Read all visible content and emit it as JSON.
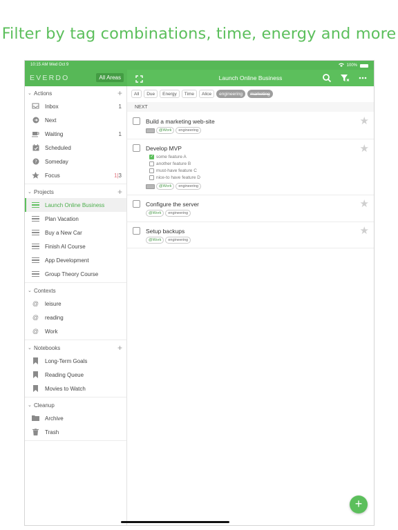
{
  "headline": "Filter by tag combinations, time, energy and more",
  "status_bar": {
    "time": "10:15 AM  Wed Oct 9",
    "battery": "100%"
  },
  "sidebar_header": {
    "brand": "EVERDO",
    "areas_button": "All Areas"
  },
  "main_header": {
    "title": "Launch Online Business"
  },
  "sidebar": {
    "actions": {
      "label": "Actions",
      "items": [
        {
          "label": "Inbox",
          "count": "1",
          "icon": "inbox-icon"
        },
        {
          "label": "Next",
          "count": "",
          "icon": "next-arrow-icon"
        },
        {
          "label": "Waiting",
          "count": "1",
          "icon": "coffee-icon"
        },
        {
          "label": "Scheduled",
          "count": "",
          "icon": "calendar-icon"
        },
        {
          "label": "Someday",
          "count": "",
          "icon": "question-icon"
        },
        {
          "label": "Focus",
          "count_a": "1",
          "count_sep": "|",
          "count_b": "3",
          "icon": "star-icon"
        }
      ]
    },
    "projects": {
      "label": "Projects",
      "items": [
        {
          "label": "Launch Online Business",
          "active": true
        },
        {
          "label": "Plan Vacation"
        },
        {
          "label": "Buy a New Car"
        },
        {
          "label": "Finish AI Course"
        },
        {
          "label": "App Development"
        },
        {
          "label": "Group Theory Course"
        }
      ]
    },
    "contexts": {
      "label": "Contexts",
      "items": [
        {
          "label": "leisure"
        },
        {
          "label": "reading"
        },
        {
          "label": "Work"
        }
      ]
    },
    "notebooks": {
      "label": "Notebooks",
      "items": [
        {
          "label": "Long-Term Goals"
        },
        {
          "label": "Reading Queue"
        },
        {
          "label": "Movies to Watch"
        }
      ]
    },
    "cleanup": {
      "label": "Cleanup",
      "items": [
        {
          "label": "Archive"
        },
        {
          "label": "Trash"
        }
      ]
    }
  },
  "filters": [
    "All",
    "Due",
    "Energy",
    "Time",
    "Alice",
    "engineering",
    "marketing"
  ],
  "section_label": "NEXT",
  "tasks": [
    {
      "title": "Build a marketing web-site",
      "context": "@Work",
      "tag": "engineering"
    },
    {
      "title": "Develop MVP",
      "context": "@Work",
      "tag": "engineering",
      "subtasks": [
        {
          "label": "some feature A",
          "done": true
        },
        {
          "label": "another feature B",
          "done": false
        },
        {
          "label": "must-have feature C",
          "done": false
        },
        {
          "label": "nice-to have feature D",
          "done": false
        }
      ]
    },
    {
      "title": "Configure the server",
      "context": "@Work",
      "tag": "engineering"
    },
    {
      "title": "Setup backups",
      "context": "@Work",
      "tag": "engineering"
    }
  ],
  "colors": {
    "accent": "#5cbf5c",
    "accent_dark": "#439c43",
    "focus_count": "#e0707a"
  }
}
